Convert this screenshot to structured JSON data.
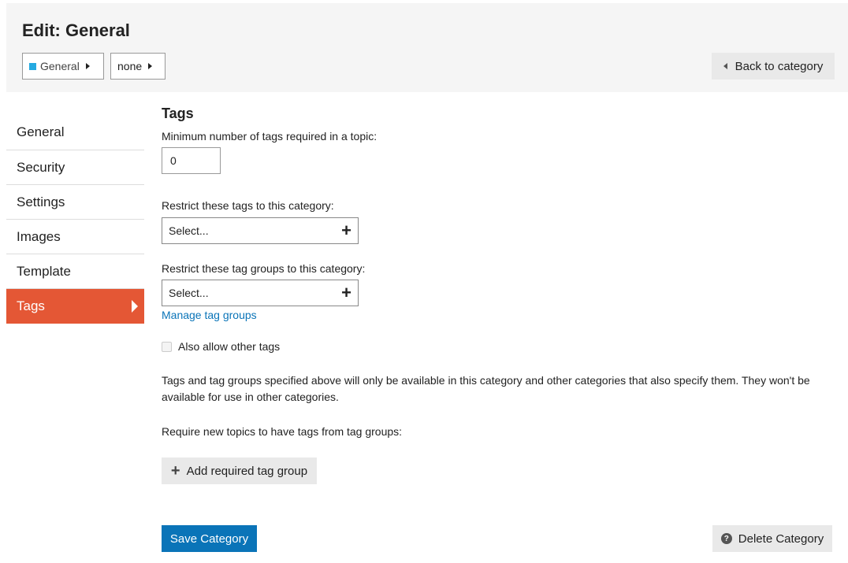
{
  "header": {
    "title": "Edit: General",
    "breadcrumbs": [
      {
        "label": "General",
        "color": "#25aae1"
      },
      {
        "label": "none"
      }
    ],
    "back_label": "Back to category"
  },
  "nav": {
    "items": [
      {
        "label": "General"
      },
      {
        "label": "Security"
      },
      {
        "label": "Settings"
      },
      {
        "label": "Images"
      },
      {
        "label": "Template"
      },
      {
        "label": "Tags",
        "active": true
      }
    ]
  },
  "tags": {
    "section_title": "Tags",
    "min_tags_label": "Minimum number of tags required in a topic:",
    "min_tags_value": "0",
    "restrict_tags_label": "Restrict these tags to this category:",
    "restrict_tags_placeholder": "Select...",
    "restrict_groups_label": "Restrict these tag groups to this category:",
    "restrict_groups_placeholder": "Select...",
    "manage_link": "Manage tag groups",
    "allow_other_label": "Also allow other tags",
    "allow_other_checked": false,
    "description": "Tags and tag groups specified above will only be available in this category and other categories that also specify them. They won't be available for use in other categories.",
    "require_label": "Require new topics to have tags from tag groups:",
    "add_required_label": "Add required tag group"
  },
  "footer": {
    "save_label": "Save Category",
    "delete_label": "Delete Category"
  },
  "colors": {
    "accent": "#e45735",
    "primary": "#0a74b8",
    "category": "#25aae1"
  }
}
